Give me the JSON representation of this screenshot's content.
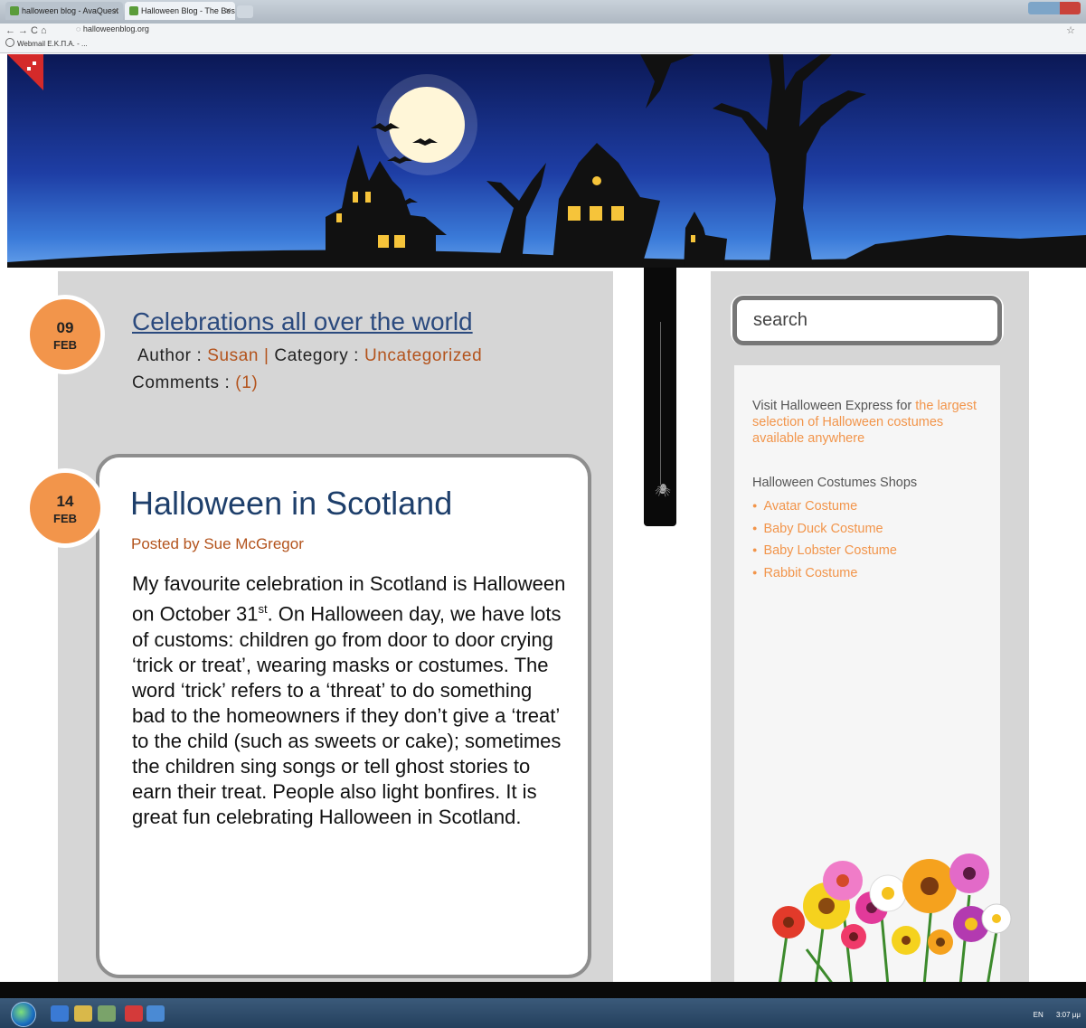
{
  "browser": {
    "tabs": [
      {
        "label": "halloween blog - AvaQuest"
      },
      {
        "label": "Halloween Blog - The Best"
      }
    ],
    "url": "halloweenblog.org",
    "bookmark": "Webmail Ε.Κ.Π.Α. - ..."
  },
  "posts": [
    {
      "day": "09",
      "month": "FEB",
      "title": "Celebrations all over the world",
      "author_prefix": "Author : ",
      "author": "Susan |",
      "category_prefix": " Category : ",
      "category": "Uncategorized",
      "comments_prefix": "Comments : ",
      "comments": "(1)"
    },
    {
      "day": "14",
      "month": "FEB",
      "title": "Halloween in Scotland",
      "posted_by": "Posted by Sue McGregor",
      "body_before_sup": "My favourite celebration in Scotland is Halloween on October 31",
      "body_sup": "st",
      "body_after_sup": ". On Halloween day, we have lots of customs: children go from door to door crying ‘trick or treat’, wearing masks or costumes. The word ‘trick’ refers to a ‘threat’ to do something bad to the homeowners if they don’t give a ‘treat’ to the child (such as sweets or cake); sometimes the children sing songs or tell ghost stories to earn their treat. People also light bonfires. It is great fun celebrating Halloween in Scotland."
    }
  ],
  "sidebar": {
    "search_placeholder": "search",
    "promo_text": "Visit Halloween Express for ",
    "promo_link": "the largest selection of Halloween costumes available anywhere",
    "shops_title": "Halloween Costumes Shops",
    "shops": [
      "Avatar Costume",
      "Baby Duck Costume",
      "Baby Lobster Costume",
      "Rabbit Costume"
    ]
  },
  "taskbar": {
    "language": "EN",
    "clock": "3:07 μμ"
  },
  "colors": {
    "accent_orange": "#f2954b",
    "link_brown": "#b3531c",
    "title_blue": "#1e3f6b",
    "column_gray": "#d6d6d6"
  }
}
